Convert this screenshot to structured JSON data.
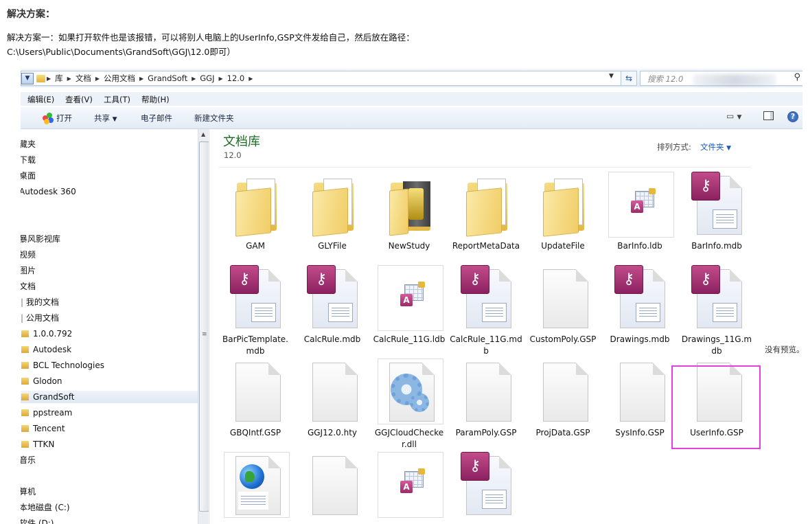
{
  "article": {
    "heading": "解决方案：",
    "line1": "解决方案一：如果打开软件也是该报错，可以将别人电脑上的UserInfo,GSP文件发给自己，然后放在路径：",
    "line2": "C:\\Users\\Public\\Documents\\GrandSoft\\GGJ\\12.0即可）"
  },
  "address_bar": {
    "breadcrumbs": [
      "库",
      "文档",
      "公用文档",
      "GrandSoft",
      "GGJ",
      "12.0"
    ],
    "search_placeholder": "搜索 12.0"
  },
  "menu": [
    "编辑(E)",
    "查看(V)",
    "工具(T)",
    "帮助(H)"
  ],
  "toolbar": {
    "open": "打开",
    "share": "共享",
    "email": "电子邮件",
    "new_folder": "新建文件夹"
  },
  "nav": [
    "藏夹",
    "下载",
    "桌面",
    "Autodesk 360",
    "暴风影视库",
    "视频",
    "图片",
    "文档",
    "我的文档",
    "公用文档",
    "1.0.0.792",
    "Autodesk",
    "BCL Technologies",
    "Glodon",
    "GrandSoft",
    "ppstream",
    "Tencent",
    "TTKN",
    "音乐",
    "算机",
    "本地磁盘 (C:)",
    "软件 (D:)"
  ],
  "library": {
    "title": "文档库",
    "subtitle": "12.0",
    "arrange_label": "排列方式:",
    "arrange_value": "文件夹"
  },
  "files": [
    {
      "name": "GAM",
      "icon": "folder-icon"
    },
    {
      "name": "GLYFile",
      "icon": "folder-icon"
    },
    {
      "name": "NewStudy",
      "icon": "folder-image-icon"
    },
    {
      "name": "ReportMetaData",
      "icon": "folder-icon"
    },
    {
      "name": "UpdateFile",
      "icon": "folder-icon"
    },
    {
      "name": "BarInfo.ldb",
      "icon": "access-lock-icon"
    },
    {
      "name": "BarInfo.mdb",
      "icon": "access-db-icon"
    },
    {
      "name": "BarPicTemplate.mdb",
      "icon": "access-db-icon"
    },
    {
      "name": "CalcRule.mdb",
      "icon": "access-db-icon"
    },
    {
      "name": "CalcRule_11G.ldb",
      "icon": "access-lock-icon"
    },
    {
      "name": "CalcRule_11G.mdb",
      "icon": "access-db-icon"
    },
    {
      "name": "CustomPoly.GSP",
      "icon": "blank-file-icon"
    },
    {
      "name": "Drawings.mdb",
      "icon": "access-db-icon"
    },
    {
      "name": "Drawings_11G.mdb",
      "icon": "access-db-icon"
    },
    {
      "name": "GBQIntf.GSP",
      "icon": "blank-file-icon"
    },
    {
      "name": "GGJ12.0.hty",
      "icon": "blank-file-icon"
    },
    {
      "name": "GGJCloudChecker.dll",
      "icon": "gear-file-icon"
    },
    {
      "name": "ParamPoly.GSP",
      "icon": "blank-file-icon"
    },
    {
      "name": "ProjData.GSP",
      "icon": "blank-file-icon"
    },
    {
      "name": "SysInfo.GSP",
      "icon": "blank-file-icon"
    },
    {
      "name": "UserInfo.GSP",
      "icon": "blank-file-icon"
    },
    {
      "name": "",
      "icon": "html-globe-icon"
    },
    {
      "name": "",
      "icon": "blank-file-icon"
    },
    {
      "name": "",
      "icon": "access-lock-icon"
    },
    {
      "name": "",
      "icon": "access-db-icon"
    }
  ],
  "preview_text": "没有预览。",
  "highlight_color": "#e43fe0"
}
